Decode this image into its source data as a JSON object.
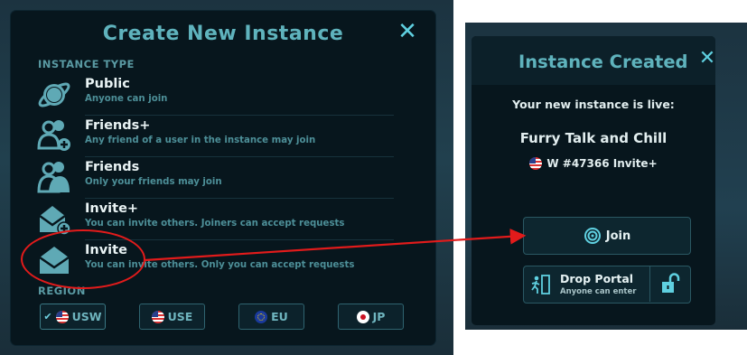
{
  "create_panel": {
    "title": "Create New Instance",
    "close_icon": "close-icon",
    "instance_type_label": "INSTANCE TYPE",
    "options": [
      {
        "icon": "planet-icon",
        "title": "Public",
        "description": "Anyone can join"
      },
      {
        "icon": "friends-plus-icon",
        "title": "Friends+",
        "description": "Any friend of a user in the instance may join"
      },
      {
        "icon": "friends-icon",
        "title": "Friends",
        "description": "Only your friends may join"
      },
      {
        "icon": "envelope-plus-icon",
        "title": "Invite+",
        "description": "You can invite others. Joiners can accept requests"
      },
      {
        "icon": "envelope-icon",
        "title": "Invite",
        "description": "You can invite others. Only you can accept requests"
      }
    ],
    "region_label": "REGION",
    "regions": [
      {
        "code": "USW",
        "flag": "us-flag-icon",
        "selected": true
      },
      {
        "code": "USE",
        "flag": "us-flag-icon",
        "selected": false
      },
      {
        "code": "EU",
        "flag": "eu-flag-icon",
        "selected": false
      },
      {
        "code": "JP",
        "flag": "jp-flag-icon",
        "selected": false
      }
    ]
  },
  "created_panel": {
    "title": "Instance Created",
    "close_icon": "close-icon",
    "message": "Your new instance is live:",
    "world_name": "Furry Talk and Chill",
    "instance_info": "W #47366 Invite+",
    "join_label": "Join",
    "drop_portal_label": "Drop Portal",
    "drop_portal_sub": "Anyone can enter"
  },
  "annotation_color": "#e21b1b"
}
